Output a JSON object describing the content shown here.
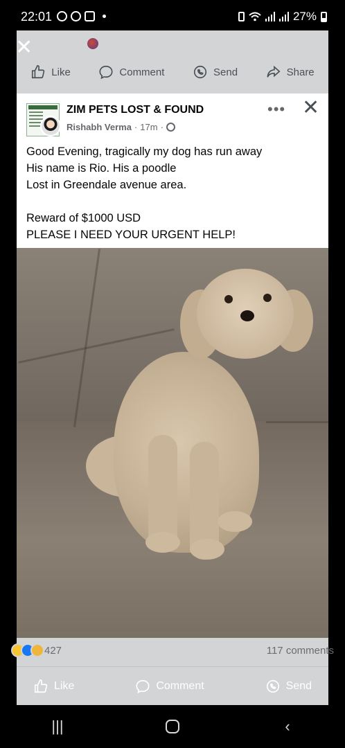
{
  "status_bar": {
    "time": "22:01",
    "battery": "27%"
  },
  "top_actions": {
    "like": "Like",
    "comment": "Comment",
    "send": "Send",
    "share": "Share"
  },
  "post": {
    "group_name": "ZIM PETS LOST & FOUND",
    "author": "Rishabh Verma",
    "time": "17m",
    "text": "Good Evening, tragically my dog has run away\nHis name is Rio. His a poodle\nLost in Greendale avenue area.\n\nReward of $1000 USD\nPLEASE I NEED YOUR URGENT HELP!"
  },
  "reactions": {
    "count": "427",
    "comments": "117 comments"
  },
  "bottom_actions": {
    "like": "Like",
    "comment": "Comment",
    "send": "Send"
  },
  "colors": {
    "accent": "#1877f2",
    "dim_background": "#d3d4d6"
  }
}
